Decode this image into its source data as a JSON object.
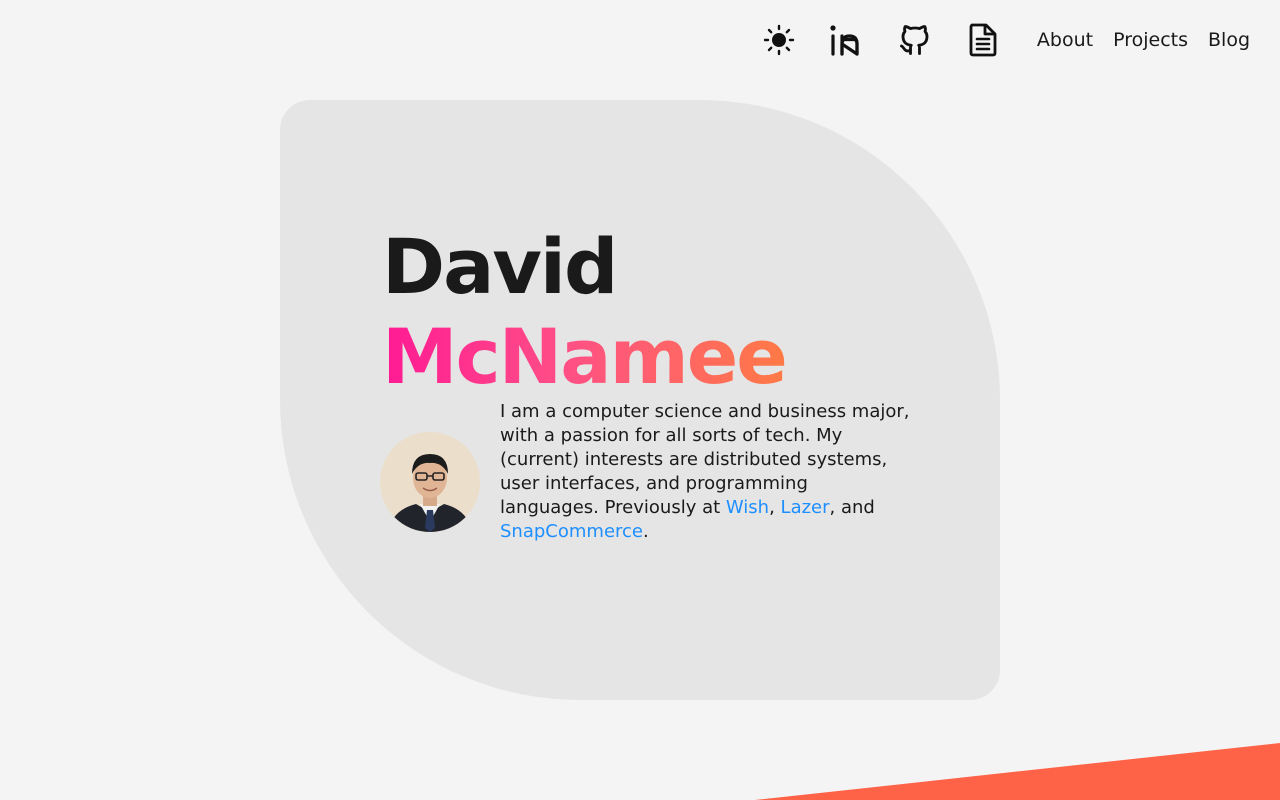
{
  "nav": {
    "icons": [
      {
        "name": "theme-toggle",
        "icon": "sun-icon"
      },
      {
        "name": "linkedin",
        "icon": "linkedin-icon"
      },
      {
        "name": "github",
        "icon": "github-icon"
      },
      {
        "name": "resume",
        "icon": "document-icon"
      }
    ],
    "links": [
      "About",
      "Projects",
      "Blog"
    ]
  },
  "hero": {
    "first_name": "David",
    "last_name": "McNamee",
    "bio": {
      "intro": "I am a computer science and business major, with a passion for all sorts of tech. My (current) interests are distributed systems, user interfaces, and programming languages. Previously at ",
      "company_1": "Wish",
      "sep_1": ", ",
      "company_2": "Lazer",
      "sep_2": ", and ",
      "company_3": "SnapCommerce",
      "end": "."
    }
  },
  "colors": {
    "background": "#f4f4f4",
    "card": "#e5e5e5",
    "link": "#1e8fff",
    "gradient_start": "#ff1a94",
    "gradient_end": "#ff7a45",
    "accent": "#ff6347"
  }
}
